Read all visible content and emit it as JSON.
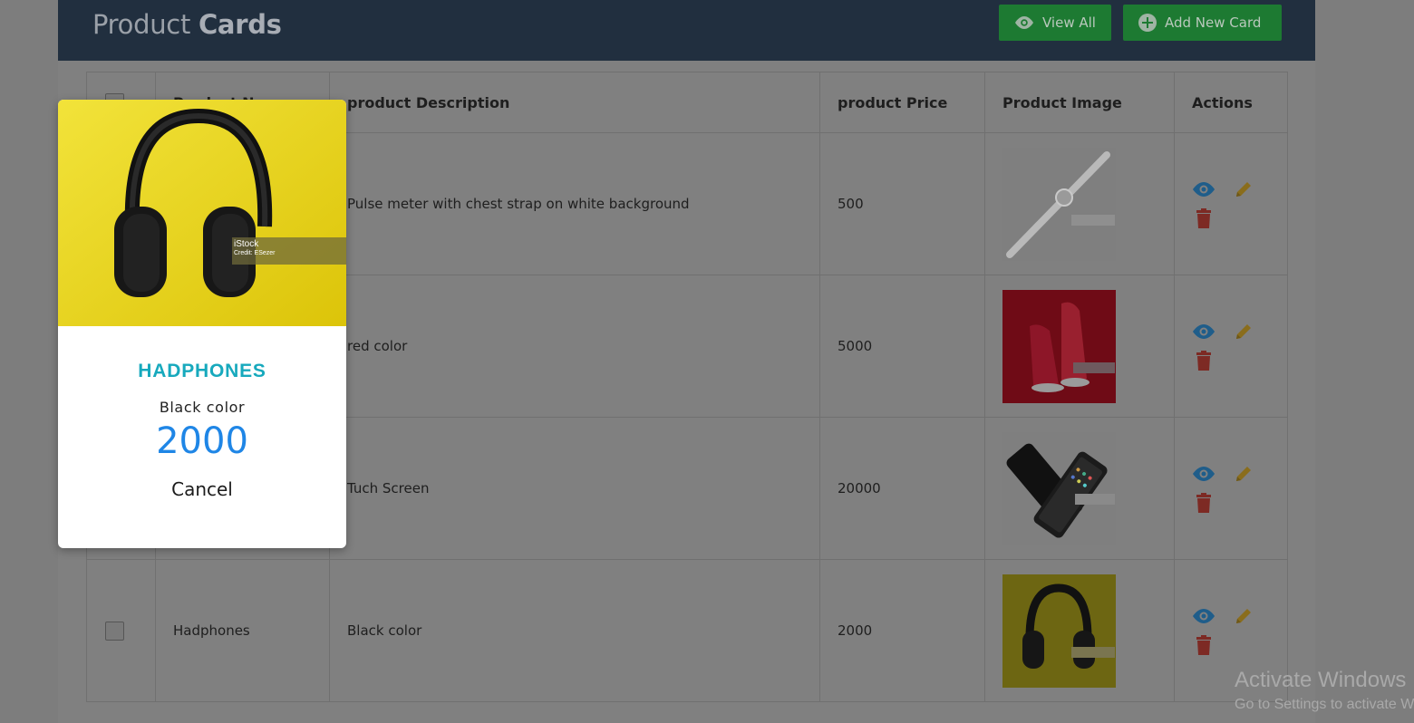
{
  "header": {
    "title_light": "Product",
    "title_bold": "Cards",
    "view_all_label": "View All",
    "add_new_label": "Add New Card"
  },
  "table": {
    "columns": [
      "",
      "Product Name",
      "product Description",
      "product Price",
      "Product Image",
      "Actions"
    ],
    "rows": [
      {
        "name": "",
        "description": "Pulse meter with chest strap on white background",
        "price": "500",
        "image": "smartwatch"
      },
      {
        "name": "",
        "description": "red color",
        "price": "5000",
        "image": "red-sneakers"
      },
      {
        "name": "",
        "description": "Tuch Screen",
        "price": "20000",
        "image": "smartphone"
      },
      {
        "name": "Hadphones",
        "description": "Black color",
        "price": "2000",
        "image": "headphones"
      }
    ]
  },
  "modal": {
    "name": "HADPHONES",
    "description": "Black color",
    "price": "2000",
    "cancel_label": "Cancel",
    "image": "headphones",
    "image_caption_brand": "iStock",
    "image_caption_credit": "Credit: ESezer"
  },
  "icons": {
    "view": "eye-icon",
    "edit": "pencil-icon",
    "delete": "trash-icon",
    "add": "plus-circle-icon"
  },
  "colors": {
    "header_bg": "#212f3f",
    "button_green": "#1d7a32",
    "view_icon": "#1f5d8a",
    "edit_icon": "#8a6d1c",
    "delete_icon": "#7d2a24",
    "modal_name": "#17a9bd",
    "modal_price": "#1f86e6"
  },
  "os_watermark": {
    "line1": "Activate Windows",
    "line2": "Go to Settings to activate Windows."
  }
}
